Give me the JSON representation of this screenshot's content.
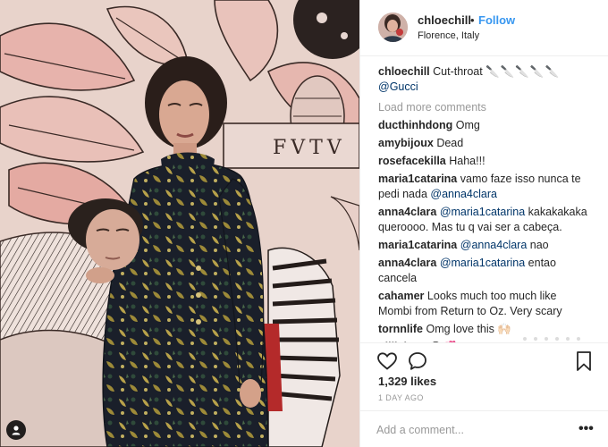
{
  "post": {
    "username": "chloechill",
    "dot": "•",
    "follow_label": "Follow",
    "location": "Florence, Italy",
    "caption_text": "Cut-throat",
    "caption_icons": "🔪🔪🔪🔪🔪",
    "caption_mention": "@Gucci",
    "mural_text": "FVTV"
  },
  "load_more_label": "Load more comments",
  "comments": [
    {
      "user": "ducthinhdong",
      "text": "Omg"
    },
    {
      "user": "amybijoux",
      "text": "Dead"
    },
    {
      "user": "rosefacekilla",
      "text": "Haha!!!"
    },
    {
      "user": "maria1catarina",
      "text": "vamo faze isso nunca te pedi nada",
      "mention": "@anna4clara"
    },
    {
      "user": "anna4clara",
      "mention": "@maria1catarina",
      "text": "kakakakaka queroooo. Mas tu q vai ser a cabeça."
    },
    {
      "user": "maria1catarina",
      "mention": "@anna4clara",
      "text": "nao"
    },
    {
      "user": "anna4clara",
      "mention": "@maria1catarina",
      "text": "entao cancela"
    },
    {
      "user": "cahamer",
      "text": "Looks much too much like Mombi from Return to Oz. Very scary"
    },
    {
      "user": "tornnlife",
      "text": "Omg love this",
      "emoji": "🙌🏻"
    },
    {
      "user": "gillielove",
      "text": "",
      "emoji": "😭💞"
    }
  ],
  "actions": {
    "likes": "1,329 likes",
    "time_ago": "1 DAY AGO",
    "comment_placeholder": "Add a comment...",
    "more_label": "•••"
  },
  "icons": {
    "like": "heart-outline-icon",
    "comment": "speech-bubble-icon",
    "save": "bookmark-icon",
    "tag": "user-tag-icon"
  },
  "colors": {
    "link_blue": "#3897f0",
    "mention_blue": "#003569",
    "muted": "#999999",
    "border": "#efefef",
    "text": "#262626"
  }
}
